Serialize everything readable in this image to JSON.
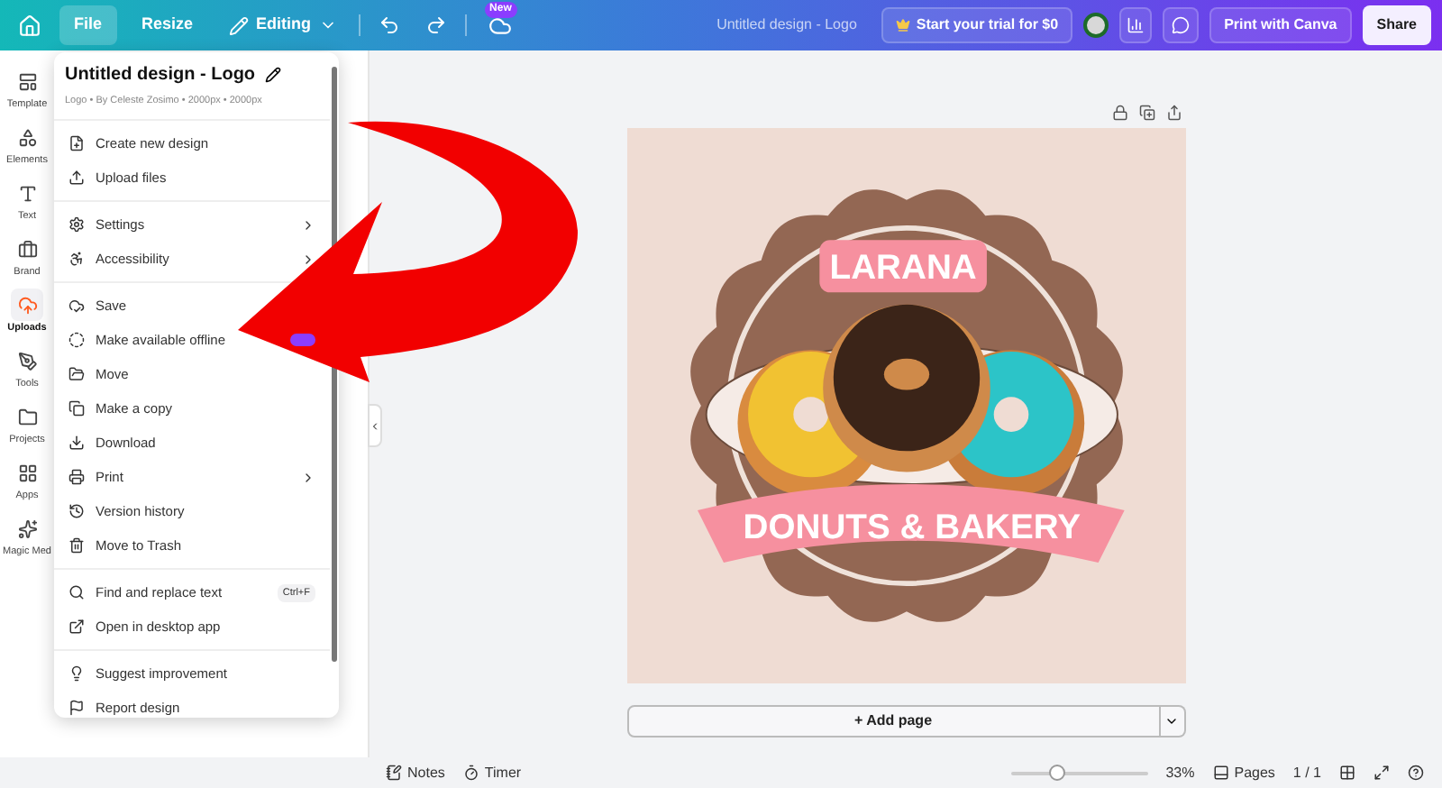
{
  "topbar": {
    "menus": [
      {
        "label": "File",
        "selected": true
      },
      {
        "label": "Resize",
        "selected": false
      }
    ],
    "editing": "Editing",
    "new_badge": "New",
    "title": "Untitled design - Logo",
    "trial": "Start your trial for $0",
    "print": "Print with Canva",
    "share": "Share"
  },
  "rail": [
    {
      "label": "Template",
      "selected": false
    },
    {
      "label": "Elements",
      "selected": false
    },
    {
      "label": "Text",
      "selected": false
    },
    {
      "label": "Brand",
      "selected": false
    },
    {
      "label": "Uploads",
      "selected": true
    },
    {
      "label": "Tools",
      "selected": false
    },
    {
      "label": "Projects",
      "selected": false
    },
    {
      "label": "Apps",
      "selected": false
    },
    {
      "label": "Magic Med",
      "selected": false
    }
  ],
  "file_menu": {
    "title": "Untitled design - Logo",
    "subtitle": "Logo • By Celeste Zosimo • 2000px • 2000px",
    "sections": [
      [
        {
          "label": "Create new design",
          "submenu": false
        },
        {
          "label": "Upload files",
          "submenu": false
        }
      ],
      [
        {
          "label": "Settings",
          "submenu": true
        },
        {
          "label": "Accessibility",
          "submenu": true
        }
      ],
      [
        {
          "label": "Save",
          "submenu": false
        },
        {
          "label": "Make available offline",
          "submenu": false,
          "badge": true
        },
        {
          "label": "Move",
          "submenu": false
        },
        {
          "label": "Make a copy",
          "submenu": false
        },
        {
          "label": "Download",
          "submenu": false
        },
        {
          "label": "Print",
          "submenu": true
        },
        {
          "label": "Version history",
          "submenu": false
        },
        {
          "label": "Move to Trash",
          "submenu": false
        }
      ],
      [
        {
          "label": "Find and replace text",
          "submenu": false,
          "shortcut": "Ctrl+F"
        },
        {
          "label": "Open in desktop app",
          "submenu": false
        }
      ],
      [
        {
          "label": "Suggest improvement",
          "submenu": false
        },
        {
          "label": "Report design",
          "submenu": false
        }
      ]
    ]
  },
  "design": {
    "name": "LARANA",
    "tagline": "DONUTS & BAKERY"
  },
  "add_page": "+ Add page",
  "footer": {
    "notes": "Notes",
    "timer": "Timer",
    "zoom": {
      "level": 0.33,
      "reading": "33%"
    },
    "pages": "Pages",
    "page_count": "1 / 1"
  }
}
